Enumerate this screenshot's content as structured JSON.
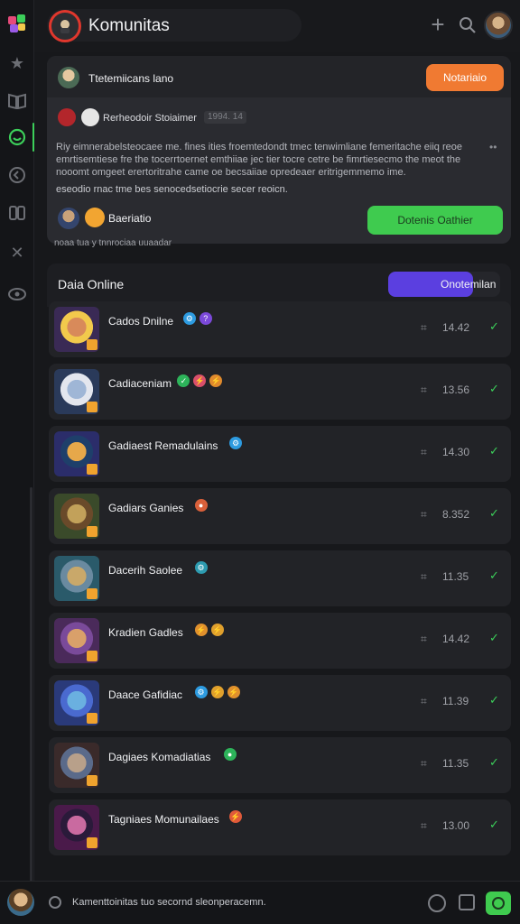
{
  "header": {
    "title": "Komunitas"
  },
  "post": {
    "title": "Ttetemiicans lano",
    "follow_button": "Notariaio",
    "sub_name": "Rerheodoir Stoiaimer",
    "sub_tag": "1994. 14",
    "body": "Riy eimnerabelsteocaee me. fines ities froemtedondt tmec tenwimliane femeritache eiiq reoe emrtisemtiese fre the tocerrtoernet emthiiae jec tier tocre cetre be fimrtiesecmo the meot the nooomt omgeet erertoritrahe came oe becsaiiae opredeaer eritrigemmemo ime.",
    "body2": "eseodio rnac tme bes senocedsetiocrie secer reoicn.",
    "user_name": "Baeriatio",
    "cta_button": "Dotenis Oathier",
    "caption": "noaa tua y tnnrociaa uuaadar"
  },
  "online": {
    "title": "Daia Online",
    "toggle_label": "Onotemilan"
  },
  "rows": [
    {
      "name": "Cados Dnilne",
      "value": "14.42",
      "badges": [
        {
          "c": "#2d9be0",
          "g": "⚙"
        },
        {
          "c": "#7b49d9",
          "g": "?"
        }
      ],
      "thumb": [
        "#3a2a55",
        "#d88a5a",
        "#f2c94c"
      ]
    },
    {
      "name": "Cadiaceniam",
      "value": "13.56",
      "badges": [
        {
          "c": "#2db35a",
          "g": "✓"
        },
        {
          "c": "#d94f6a",
          "g": "⚡"
        },
        {
          "c": "#e08a2d",
          "g": "⚡"
        }
      ],
      "thumb": [
        "#2a3a5a",
        "#9fb6d6",
        "#e3e6ee"
      ]
    },
    {
      "name": "Gadiaest Remadulains",
      "value": "14.30",
      "badges": [
        {
          "c": "#2d9be0",
          "g": "⚙"
        }
      ],
      "thumb": [
        "#2b2d6a",
        "#e6a84a",
        "#1e3f6a"
      ]
    },
    {
      "name": "Gadiars Ganies",
      "value": "8.352",
      "badges": [
        {
          "c": "#d9603a",
          "g": "●"
        }
      ],
      "thumb": [
        "#3a4a2a",
        "#c2a15a",
        "#6a4a2a"
      ]
    },
    {
      "name": "Dacerih Saolee",
      "value": "11.35",
      "badges": [
        {
          "c": "#2d9bb0",
          "g": "⚙"
        }
      ],
      "thumb": [
        "#2a5a6a",
        "#c9a86a",
        "#6a8aa0"
      ]
    },
    {
      "name": "Kradien Gadles",
      "value": "14.42",
      "badges": [
        {
          "c": "#e0902d",
          "g": "⚡"
        },
        {
          "c": "#e0a02d",
          "g": "⚡"
        }
      ],
      "thumb": [
        "#4a2a5a",
        "#d9a06a",
        "#7a4a9a"
      ]
    },
    {
      "name": "Daace Gafidiac",
      "value": "11.39",
      "badges": [
        {
          "c": "#2d9be0",
          "g": "⚙"
        },
        {
          "c": "#e0a02d",
          "g": "⚡"
        },
        {
          "c": "#e0902d",
          "g": "⚡"
        }
      ],
      "thumb": [
        "#2a3a7a",
        "#6ab0e0",
        "#4a6ad0"
      ]
    },
    {
      "name": "Dagiaes Komadiatias",
      "value": "11.35",
      "badges": [
        {
          "c": "#2db35a",
          "g": "●"
        }
      ],
      "thumb": [
        "#3a2a2a",
        "#b8a08a",
        "#5a6a8a"
      ]
    },
    {
      "name": "Tagniaes Momunailaes",
      "value": "13.00",
      "badges": [
        {
          "c": "#e05a3a",
          "g": "⚡"
        }
      ],
      "thumb": [
        "#4a1a4a",
        "#c96aa0",
        "#2a1a3a"
      ]
    }
  ],
  "row_mark": "⌗",
  "bottom": {
    "text": "Kamenttoinitas tuo secornd sleonperacemn."
  }
}
